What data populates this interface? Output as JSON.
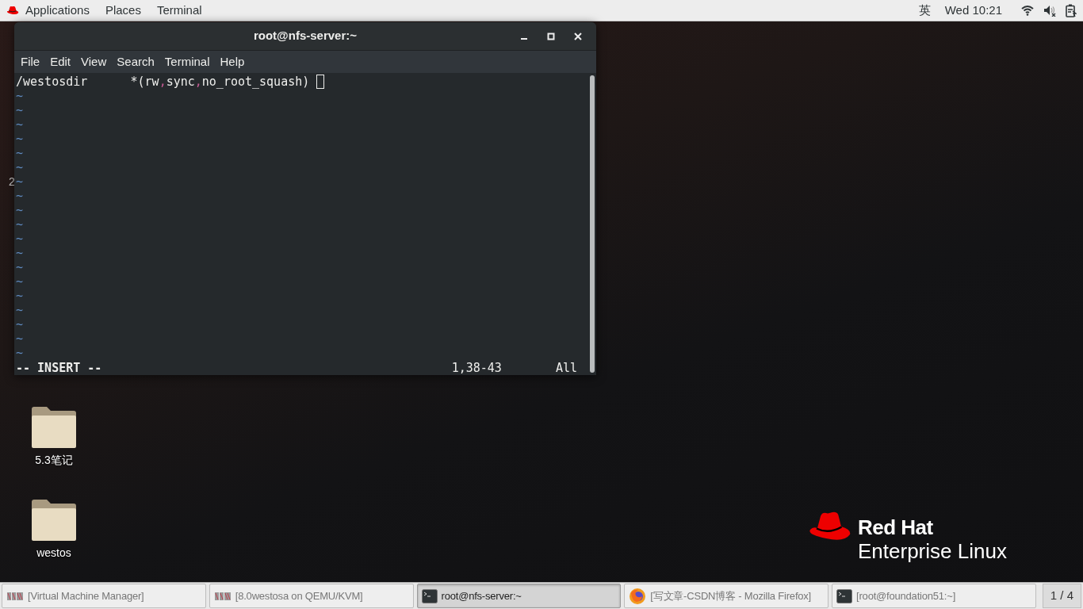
{
  "top_bar": {
    "menus": [
      "Applications",
      "Places",
      "Terminal"
    ],
    "input_method": "英",
    "clock": "Wed 10:21"
  },
  "behind_text": "2",
  "terminal": {
    "title": "root@nfs-server:~",
    "menu": [
      "File",
      "Edit",
      "View",
      "Search",
      "Terminal",
      "Help"
    ],
    "line": [
      {
        "kind": "text",
        "text": "/westosdir      *(rw"
      },
      {
        "kind": "punct",
        "text": ","
      },
      {
        "kind": "text",
        "text": "sync"
      },
      {
        "kind": "punct",
        "text": ","
      },
      {
        "kind": "text",
        "text": "no_root_squash)"
      }
    ],
    "tildes": [
      "~",
      "~",
      "~",
      "~",
      "~",
      "~",
      "~",
      "~",
      "~",
      "~",
      "~",
      "~",
      "~",
      "~",
      "~",
      "~",
      "~",
      "~",
      "~"
    ],
    "mode": "-- INSERT --",
    "position": "1,38-43",
    "scroll": "All"
  },
  "desktop_icons": [
    {
      "label": "5.3笔记"
    },
    {
      "label": "westos"
    }
  ],
  "logo": {
    "line_1": "Red Hat",
    "line_2": "Enterprise Linux"
  },
  "taskbar": [
    {
      "label": "[Virtual Machine Manager]",
      "kind": "vm",
      "selected": false
    },
    {
      "label": "[8.0westosa on QEMU/KVM]",
      "kind": "vm",
      "selected": false
    },
    {
      "label": "root@nfs-server:~",
      "kind": "terminal",
      "selected": true
    },
    {
      "label": "[写文章-CSDN博客 - Mozilla Firefox]",
      "kind": "browser",
      "selected": false
    },
    {
      "label": "[root@foundation51:~]",
      "kind": "terminal",
      "selected": false
    }
  ],
  "pager": "1 / 4"
}
